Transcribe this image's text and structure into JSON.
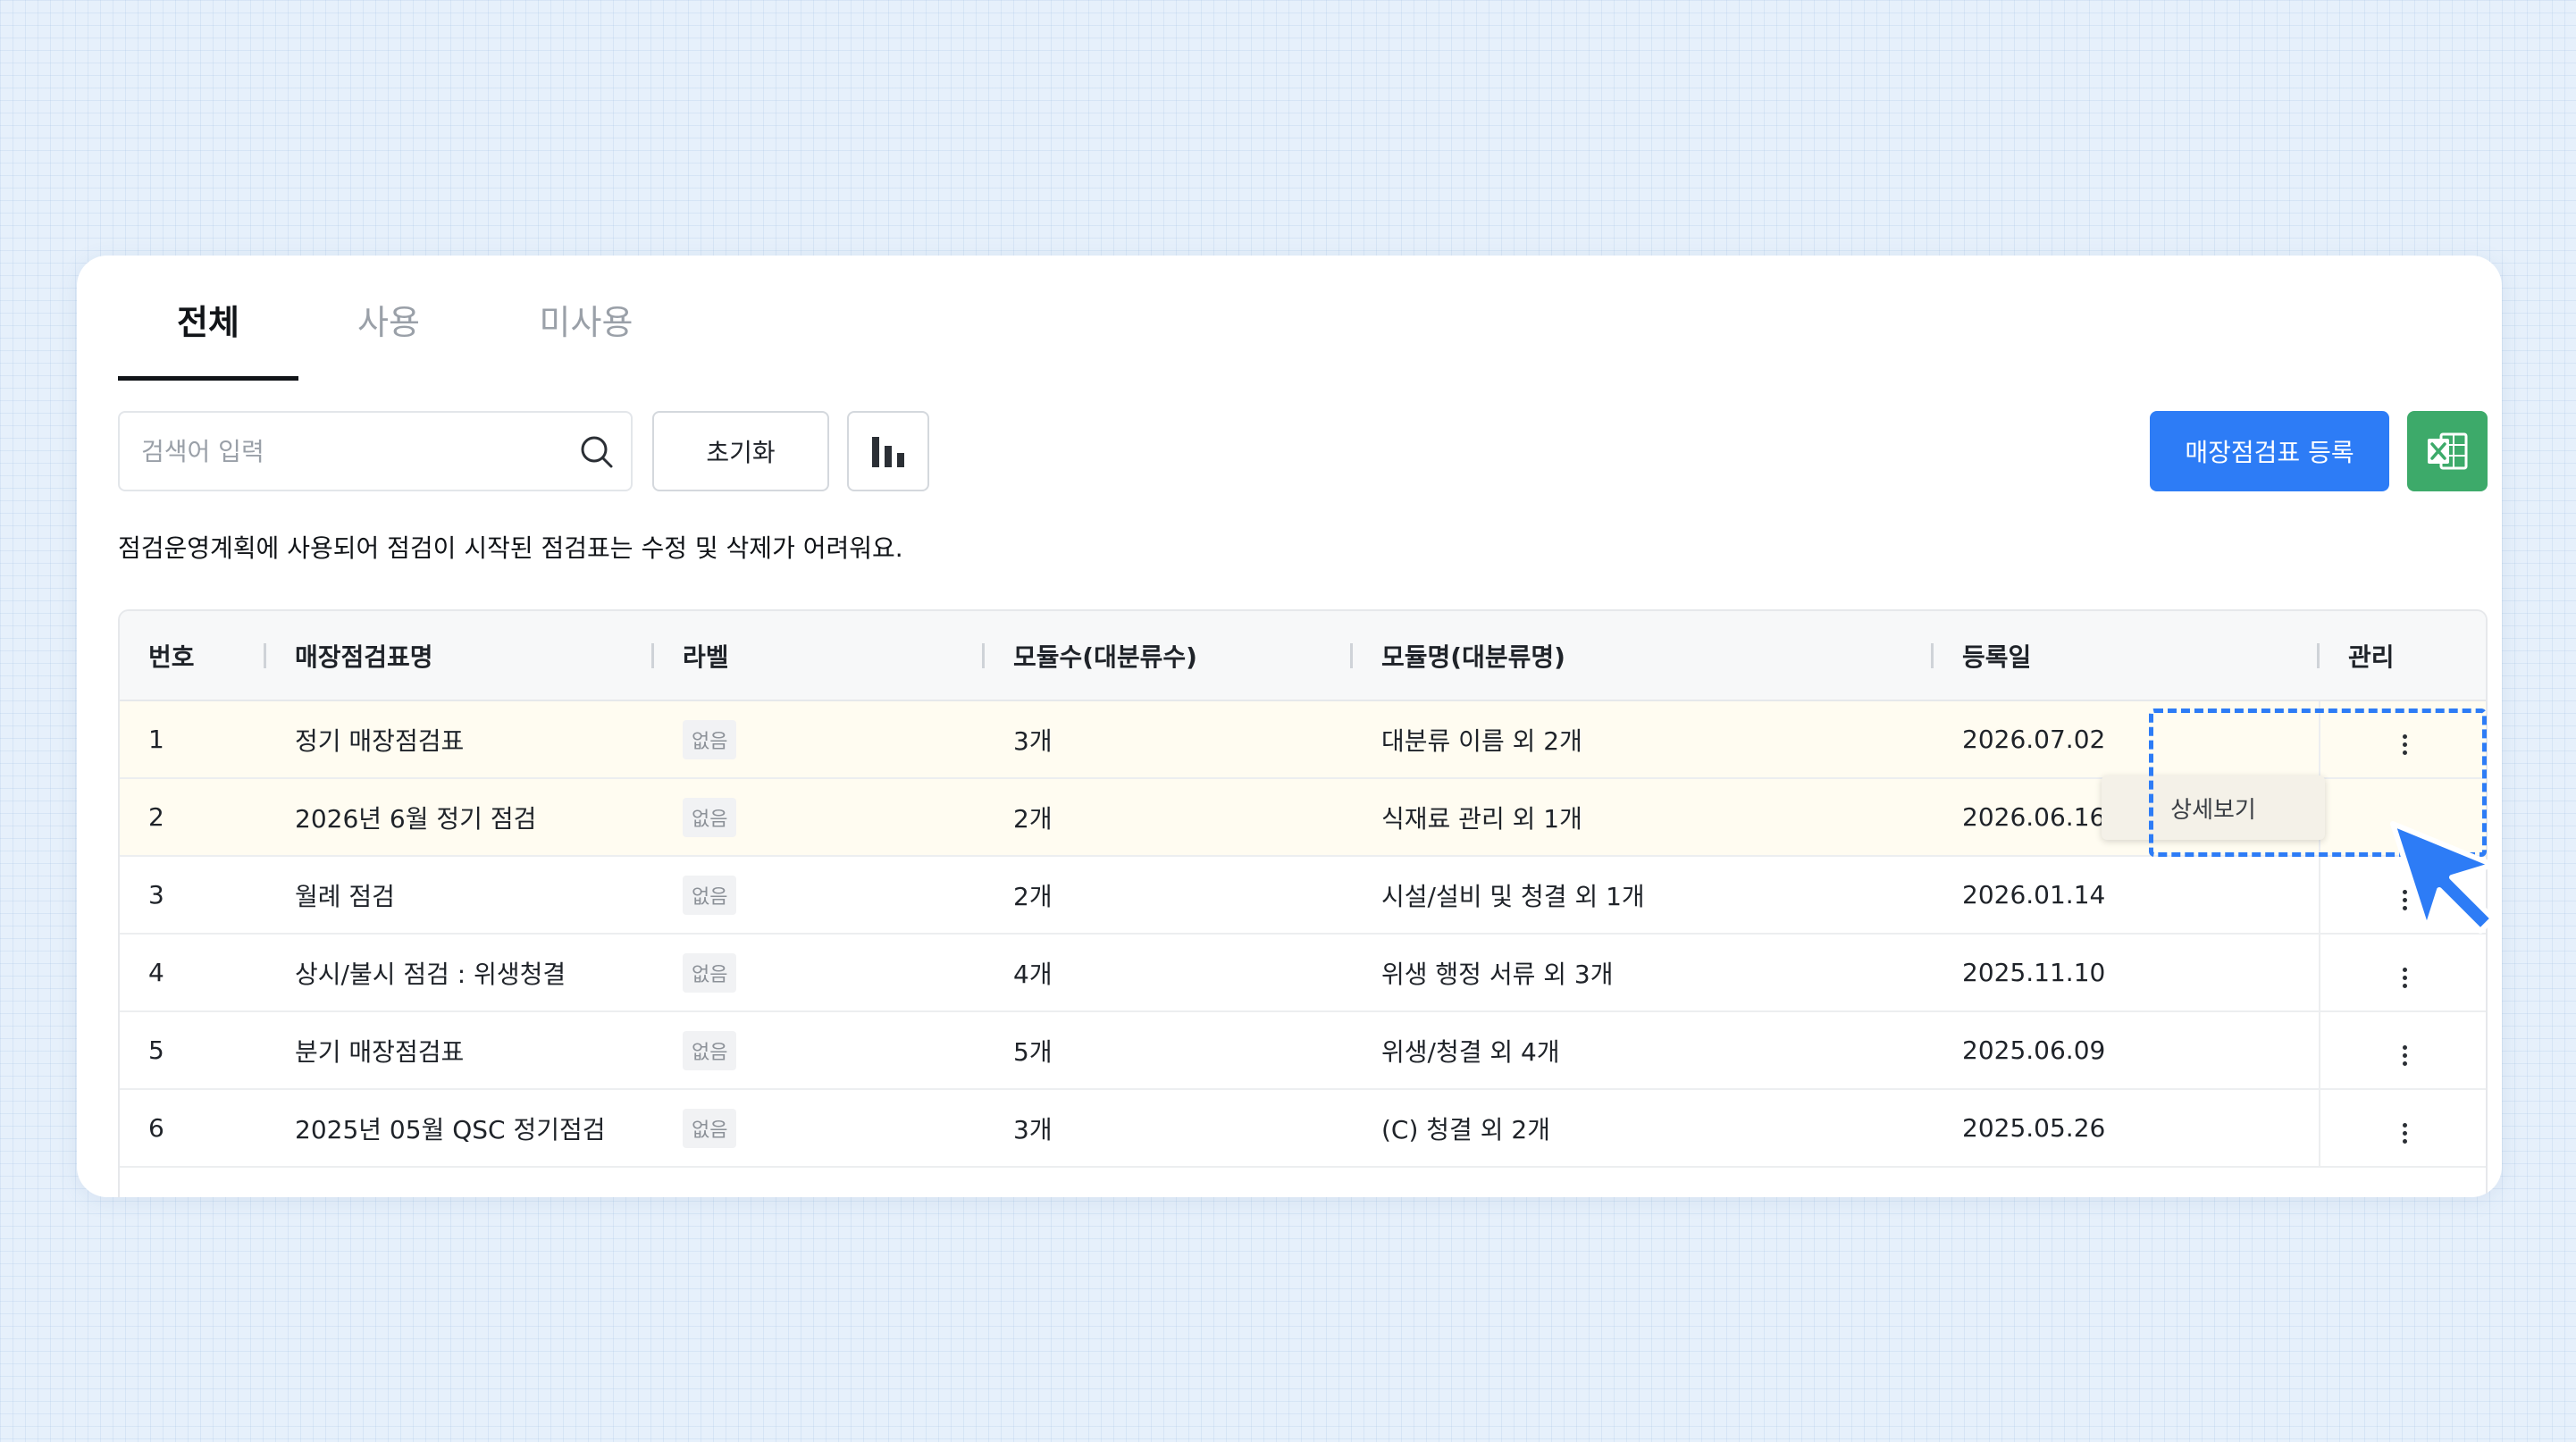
{
  "tabs": [
    {
      "label": "전체",
      "active": true
    },
    {
      "label": "사용",
      "active": false
    },
    {
      "label": "미사용",
      "active": false
    }
  ],
  "search": {
    "placeholder": "검색어 입력",
    "value": ""
  },
  "toolbar": {
    "reset_label": "초기화",
    "chart_icon": "bar-chart-icon",
    "register_label": "매장점검표 등록",
    "excel_icon": "excel-icon"
  },
  "notice": "점검운영계획에 사용되어 점검이 시작된 점검표는 수정 및 삭제가 어려워요.",
  "table": {
    "columns": [
      "번호",
      "매장점검표명",
      "라벨",
      "모듈수(대분류수)",
      "모듈명(대분류명)",
      "등록일",
      "관리"
    ],
    "rows": [
      {
        "no": "1",
        "name": "정기 매장점검표",
        "label": "없음",
        "modules": "3개",
        "module_names": "대분류 이름 외 2개",
        "date": "2026.07.02"
      },
      {
        "no": "2",
        "name": "2026년 6월 정기 점검",
        "label": "없음",
        "modules": "2개",
        "module_names": "식재료 관리 외 1개",
        "date": "2026.06.16"
      },
      {
        "no": "3",
        "name": "월례 점검",
        "label": "없음",
        "modules": "2개",
        "module_names": "시설/설비 및 청결 외 1개",
        "date": "2026.01.14"
      },
      {
        "no": "4",
        "name": "상시/불시 점검 : 위생청결",
        "label": "없음",
        "modules": "4개",
        "module_names": "위생 행정 서류 외 3개",
        "date": "2025.11.10"
      },
      {
        "no": "5",
        "name": "분기 매장점검표",
        "label": "없음",
        "modules": "5개",
        "module_names": "위생/청결 외 4개",
        "date": "2025.06.09"
      },
      {
        "no": "6",
        "name": "2025년 05월 QSC 정기점검",
        "label": "없음",
        "modules": "3개",
        "module_names": "(C) 청결 외 2개",
        "date": "2025.05.26"
      }
    ]
  },
  "dropdown": {
    "item_label": "상세보기"
  },
  "colors": {
    "primary": "#2d7cf6",
    "excel": "#3daa6a",
    "highlight_row": "#fffcf1",
    "background": "#e6f0fb"
  }
}
